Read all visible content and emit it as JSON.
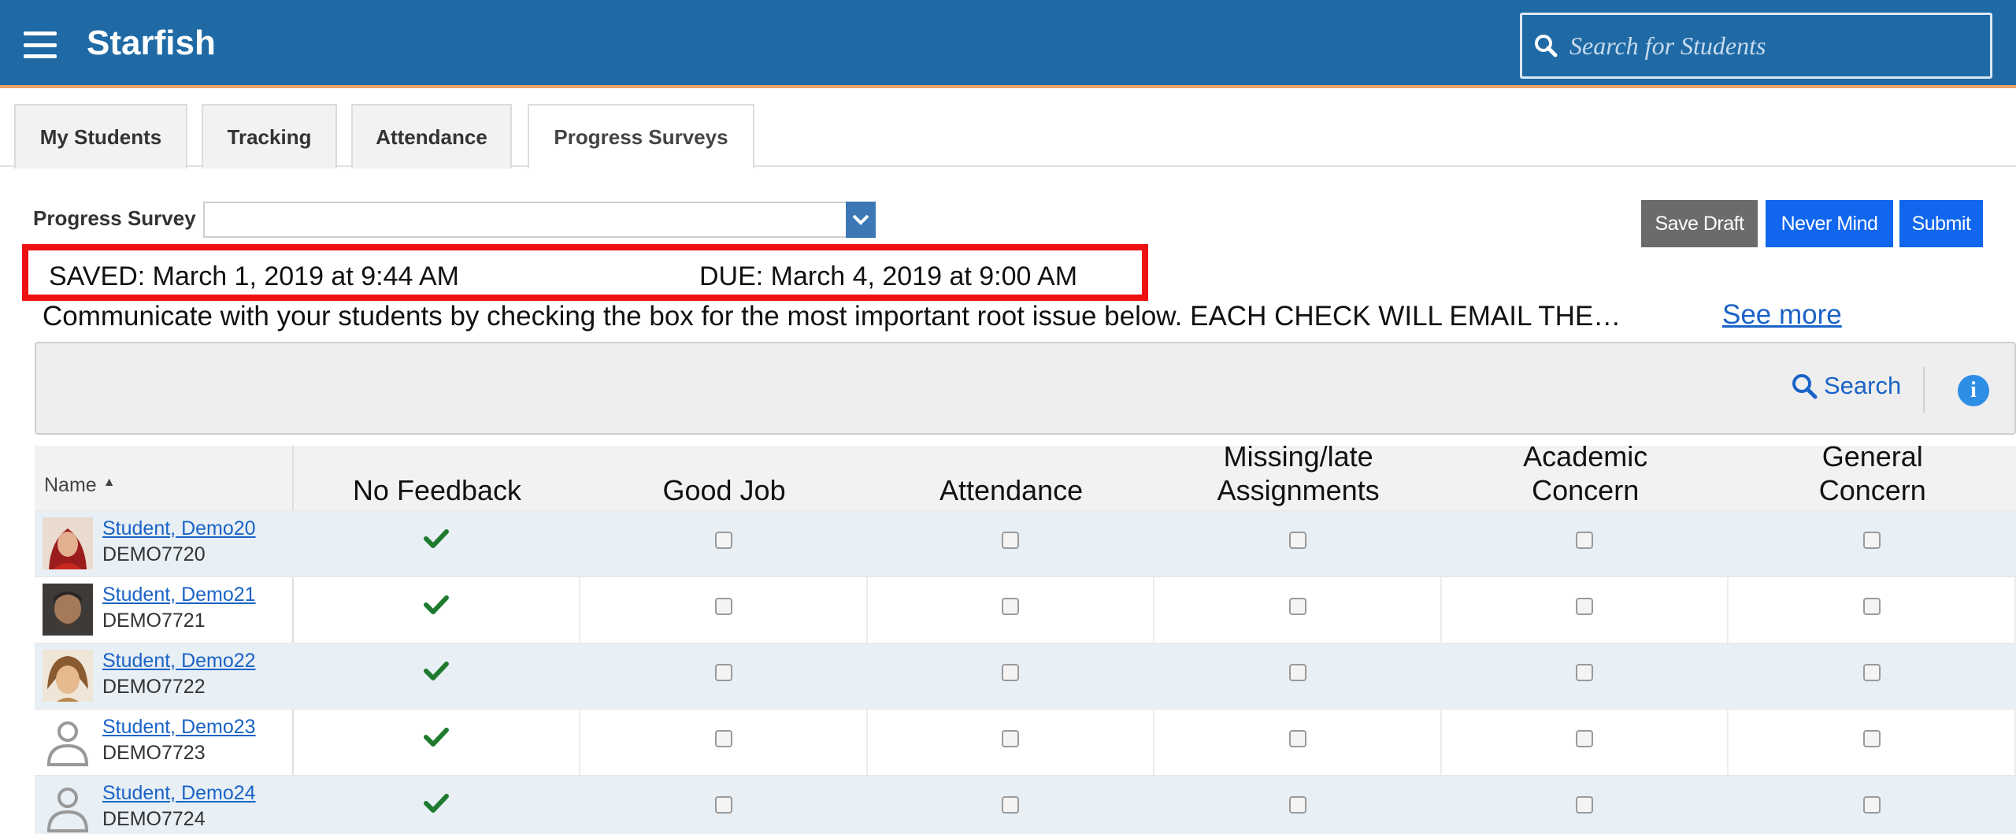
{
  "app": {
    "title": "Starfish"
  },
  "search": {
    "placeholder": "Search for Students"
  },
  "tabs": [
    {
      "label": "My Students"
    },
    {
      "label": "Tracking"
    },
    {
      "label": "Attendance"
    },
    {
      "label": "Progress Surveys"
    }
  ],
  "survey": {
    "label": "Progress Survey",
    "selected": ""
  },
  "buttons": {
    "save_draft": "Save Draft",
    "never_mind": "Never Mind",
    "submit": "Submit"
  },
  "status": {
    "saved": "SAVED: March 1, 2019 at 9:44 AM",
    "due": "DUE: March 4, 2019 at 9:00 AM"
  },
  "instructions": {
    "text": "Communicate with your students by checking the box for the most important root issue below. EACH CHECK WILL EMAIL THE…",
    "see_more": "See more"
  },
  "filter": {
    "search_label": "Search"
  },
  "table": {
    "name_header": "Name",
    "columns": [
      {
        "line1": "",
        "line2": "No Feedback"
      },
      {
        "line1": "",
        "line2": "Good Job"
      },
      {
        "line1": "",
        "line2": "Attendance"
      },
      {
        "line1": "Missing/late",
        "line2": "Assignments"
      },
      {
        "line1": "Academic",
        "line2": "Concern"
      },
      {
        "line1": "General",
        "line2": "Concern"
      }
    ],
    "rows": [
      {
        "name": "Student, Demo20",
        "id": "DEMO7720",
        "avatar": "photo-red"
      },
      {
        "name": "Student, Demo21",
        "id": "DEMO7721",
        "avatar": "photo-dark"
      },
      {
        "name": "Student, Demo22",
        "id": "DEMO7722",
        "avatar": "photo-tan"
      },
      {
        "name": "Student, Demo23",
        "id": "DEMO7723",
        "avatar": "generic-person"
      },
      {
        "name": "Student, Demo24",
        "id": "DEMO7724",
        "avatar": "generic-person"
      }
    ]
  },
  "colors": {
    "header_bg": "#1f6aa5",
    "accent_blue": "#1166ee",
    "link": "#1a63c7",
    "check_green": "#1e7a2e",
    "highlight_red": "#ee1111"
  }
}
